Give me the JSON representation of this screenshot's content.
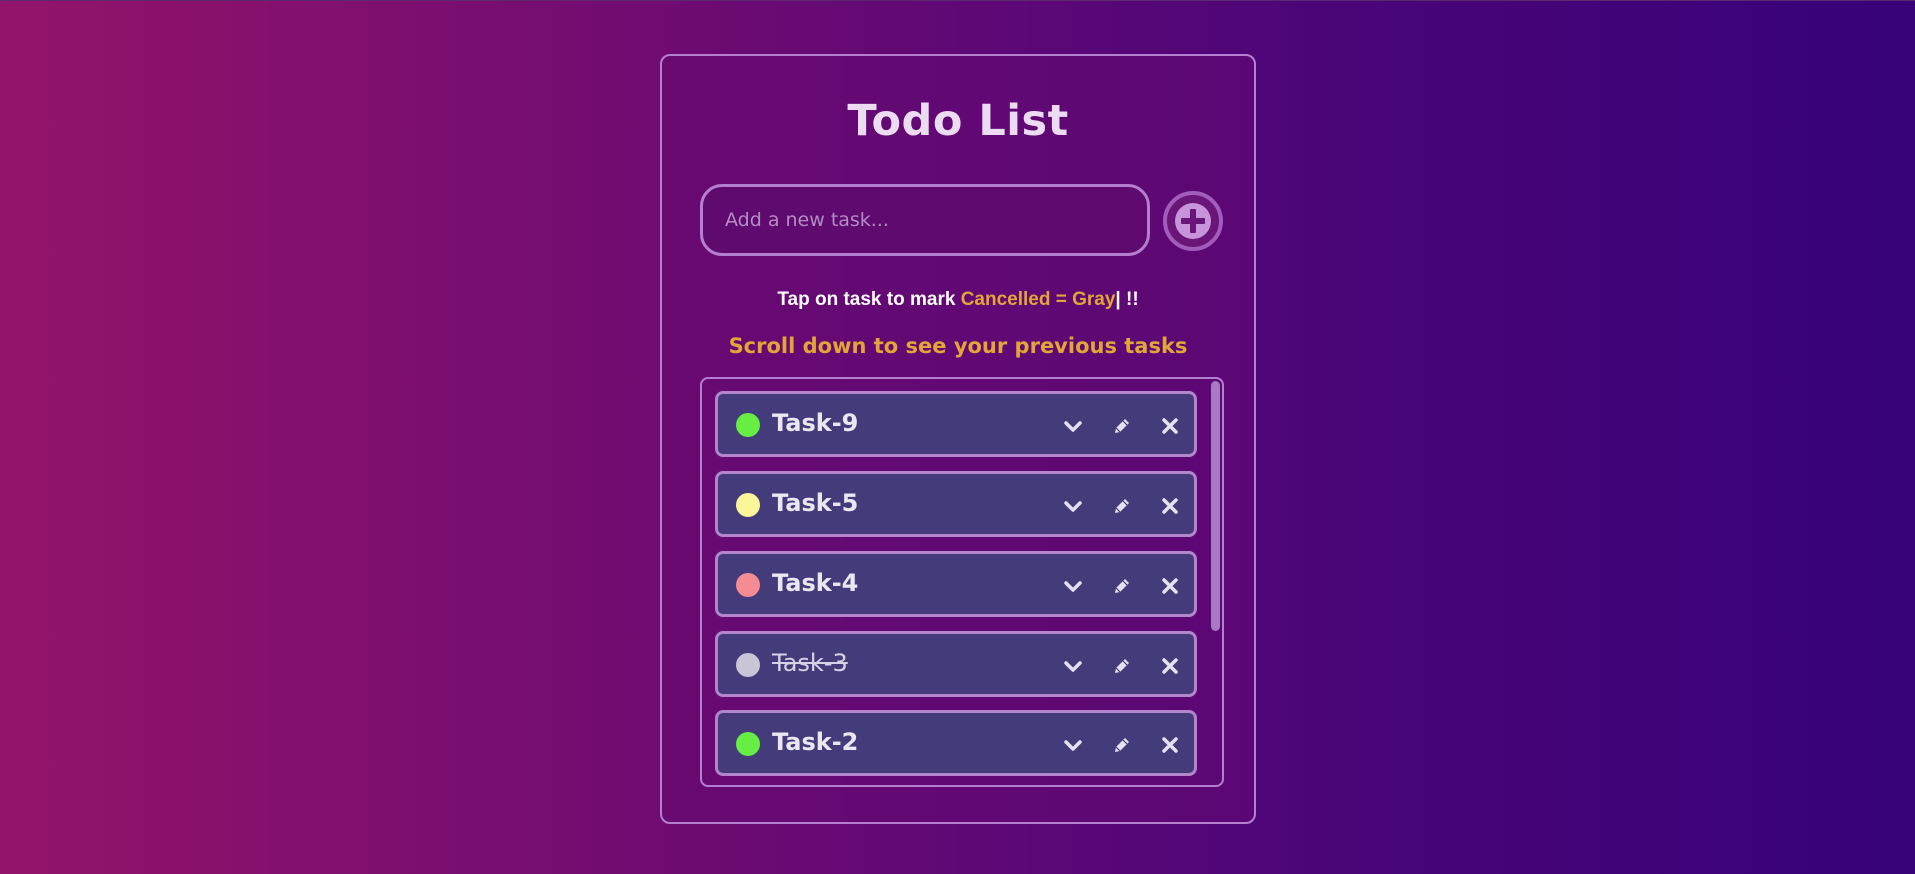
{
  "app": {
    "title": "Todo List"
  },
  "input": {
    "placeholder": "Add a new task...",
    "value": ""
  },
  "add_button": {
    "icon": "plus-circle-icon"
  },
  "hint": {
    "prefix": "Tap on task to mark ",
    "highlight": "Cancelled = Gray",
    "suffix": "| !!"
  },
  "scroll_hint": "Scroll down to see your previous tasks",
  "colors": {
    "accent": "#e2a637",
    "card_border": "#b57fcf",
    "task_bg": "#443c7a"
  },
  "tasks": [
    {
      "label": "Task-9",
      "status_color": "#66ef42",
      "cancelled": false
    },
    {
      "label": "Task-5",
      "status_color": "#fcf69b",
      "cancelled": false
    },
    {
      "label": "Task-4",
      "status_color": "#f58c93",
      "cancelled": false
    },
    {
      "label": "Task-3",
      "status_color": "#c9c5d7",
      "cancelled": true
    },
    {
      "label": "Task-2",
      "status_color": "#66ef42",
      "cancelled": false
    }
  ],
  "task_actions": {
    "expand_icon": "chevron-down-icon",
    "edit_icon": "pencil-icon",
    "delete_icon": "close-icon"
  }
}
